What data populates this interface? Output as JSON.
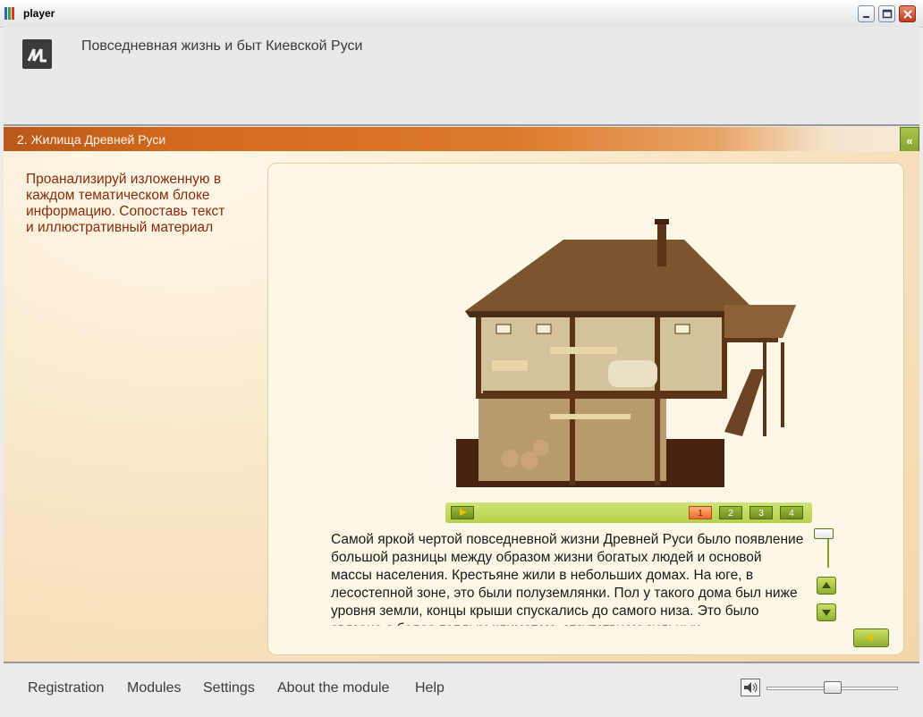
{
  "window": {
    "title": "player"
  },
  "header": {
    "title": "Повседневная жизнь и быт Киевской Руси"
  },
  "section": {
    "title": "2. Жилища Древней Руси",
    "collapse_label": "«"
  },
  "instruction": "Проанализируй изложенную в каждом тематическом блоке информацию. Сопоставь текст и иллюстративный материал",
  "slides": {
    "pages": [
      "1",
      "2",
      "3",
      "4"
    ],
    "active": "1"
  },
  "body_text": "Самой яркой чертой повседневной жизни Древней Руси было появление большой разницы между образом жизни богатых людей и основой массы населения. Крестьяне жили в небольших домах. На юге, в лесостепной зоне, это были полуземлянки. Пол у такого дома был ниже уровня земли, концы крыши спускались до самого низа. Это было связано с более теплым климатом, отсутствием сильных",
  "footer": {
    "menu": [
      "Registration",
      "Modules",
      "Settings",
      "About the module",
      "Help"
    ],
    "volume": 0.5
  },
  "colors": {
    "accent_orange": "#d46a1d",
    "accent_green": "#b5d04a",
    "instruction_text": "#8a2b0e"
  }
}
